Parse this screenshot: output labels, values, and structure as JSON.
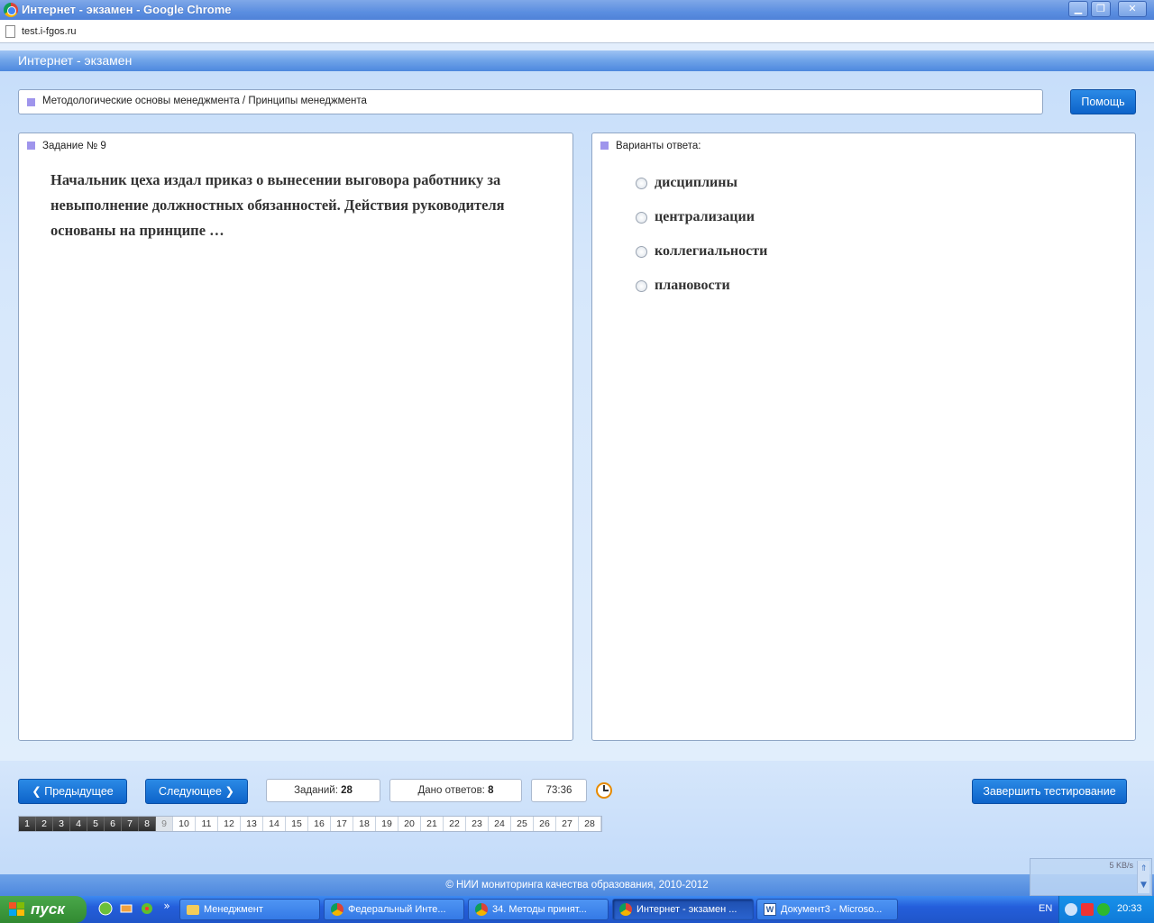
{
  "window": {
    "title": "Интернет - экзамен - Google Chrome",
    "min_glyph": "▁",
    "max_glyph": "❐",
    "close_glyph": "✕"
  },
  "browser": {
    "url": "test.i-fgos.ru"
  },
  "page": {
    "app_title": "Интернет - экзамен",
    "breadcrumb": "Методологические основы менеджмента / Принципы менеджмента",
    "help_label": "Помощь"
  },
  "question": {
    "header": "Задание № 9",
    "text": "Начальник цеха издал приказ о вынесении выговора работнику за невыполнение должностных обязанностей. Действия руководителя основаны на принципе …"
  },
  "answers": {
    "header": "Варианты ответа:",
    "options": [
      "дисциплины",
      "централизации",
      "коллегиальности",
      "плановости"
    ]
  },
  "nav": {
    "prev_label": "Предыдущее",
    "next_label": "Следующее",
    "prev_glyph": "❮",
    "next_glyph": "❯",
    "tasks_label": "Заданий:",
    "tasks_value": "28",
    "answered_label": "Дано ответов:",
    "answered_value": "8",
    "timer": "73:36",
    "finish_label": "Завершить тестирование",
    "current_page": 9,
    "pages": [
      "1",
      "2",
      "3",
      "4",
      "5",
      "6",
      "7",
      "8",
      "9",
      "10",
      "11",
      "12",
      "13",
      "14",
      "15",
      "16",
      "17",
      "18",
      "19",
      "20",
      "21",
      "22",
      "23",
      "24",
      "25",
      "26",
      "27",
      "28"
    ]
  },
  "footer": {
    "copyright": "© НИИ мониторинга качества образования, 2010-2012"
  },
  "speed_widget": {
    "speed": "5 KB/s",
    "up_glyph": "⇑",
    "down_glyph": "▼"
  },
  "taskbar": {
    "start_label": "пуск",
    "quicklaunch_more": "»",
    "buttons": [
      {
        "label": "Менеджмент",
        "icon": "folder-icon"
      },
      {
        "label": "Федеральный Инте...",
        "icon": "chrome-icon"
      },
      {
        "label": "34. Методы принят...",
        "icon": "chrome-icon"
      },
      {
        "label": "Интернет - экзамен ...",
        "icon": "chrome-icon"
      },
      {
        "label": "Документ3 - Microso...",
        "icon": "word-icon"
      }
    ],
    "word_glyph": "W",
    "lang": "EN",
    "clock": "20:33"
  },
  "colors": {
    "accent": "#0d63c9",
    "header": "#4d88de",
    "square": "#9f95ec"
  }
}
